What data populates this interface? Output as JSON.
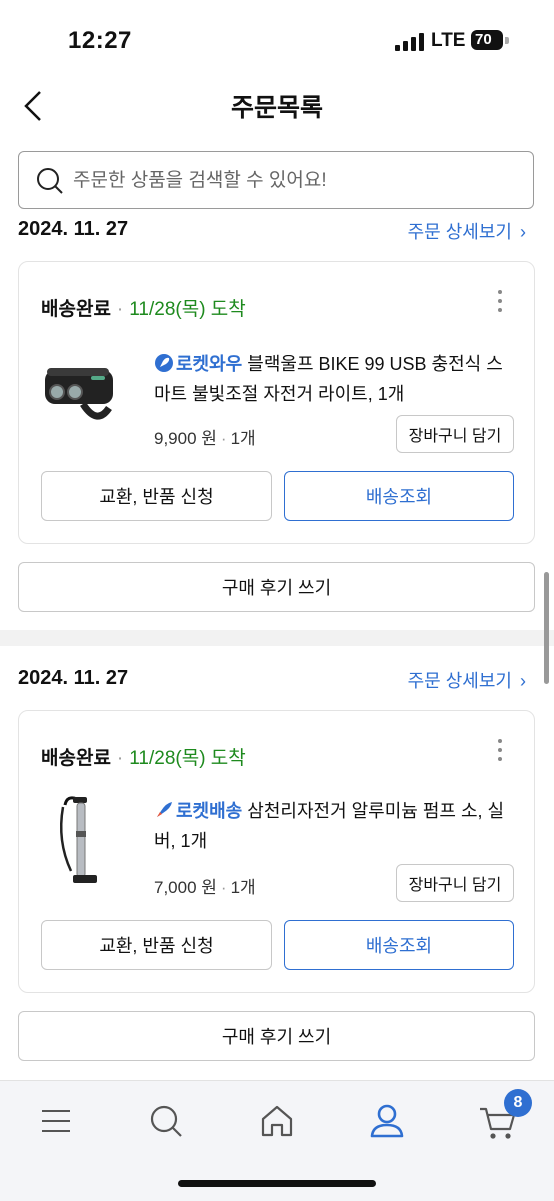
{
  "status_bar": {
    "time": "12:27",
    "network": "LTE",
    "battery": "70"
  },
  "header": {
    "title": "주문목록"
  },
  "search": {
    "placeholder": "주문한 상품을 검색할 수 있어요!"
  },
  "orders": [
    {
      "date": "2024. 11. 27",
      "detail_link": "주문 상세보기",
      "status": "배송완료",
      "arrival": "11/28(목) 도착",
      "badge": "로켓와우",
      "product": "블랙울프 BIKE 99 USB 충전식 스마트 불빛조절 자전거 라이트, 1개",
      "price": "9,900 원",
      "quantity": "1개",
      "cart_button": "장바구니 담기",
      "return_button": "교환, 반품 신청",
      "track_button": "배송조회",
      "review_button": "구매 후기 쓰기",
      "thumbnail_icon": "bike-light-icon"
    },
    {
      "date": "2024. 11. 27",
      "detail_link": "주문 상세보기",
      "status": "배송완료",
      "arrival": "11/28(목) 도착",
      "badge": "로켓배송",
      "product": "삼천리자전거 알루미늄 펌프 소, 실버, 1개",
      "price": "7,000 원",
      "quantity": "1개",
      "cart_button": "장바구니 담기",
      "return_button": "교환, 반품 신청",
      "track_button": "배송조회",
      "review_button": "구매 후기 쓰기",
      "thumbnail_icon": "bike-pump-icon"
    }
  ],
  "tabbar": {
    "items": [
      "menu-icon",
      "search-icon",
      "home-icon",
      "my-page-icon",
      "cart-icon"
    ],
    "cart_count": "8"
  },
  "colors": {
    "accent": "#2f6fd1",
    "arrival": "#1e8a1e",
    "border": "#c8c8c8"
  }
}
